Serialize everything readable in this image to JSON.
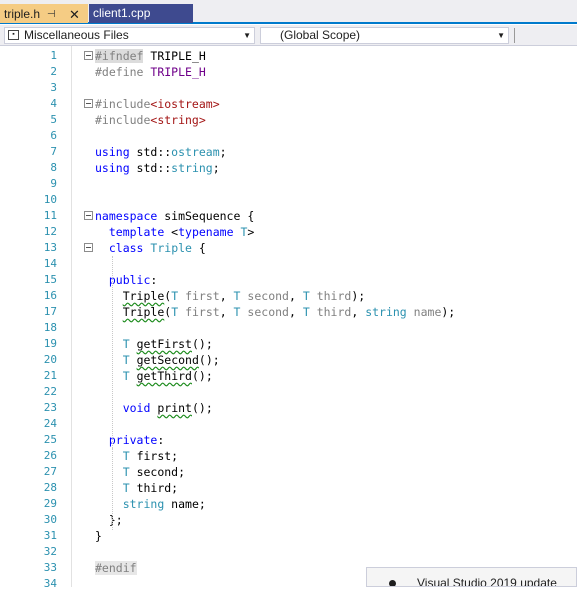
{
  "tabs": [
    {
      "label": "triple.h",
      "active": true
    },
    {
      "label": "client1.cpp",
      "active": false
    }
  ],
  "tab_icons": {
    "pin": "pin-icon",
    "close": "close-icon"
  },
  "navbar": {
    "files_dropdown": "Miscellaneous Files",
    "scope_dropdown": "(Global Scope)"
  },
  "colors": {
    "accent": "#007acc",
    "active_tab": "#f5cc84",
    "inactive_tab": "#3e4a8f",
    "line_numbers": "#2b91af",
    "keyword": "#0000ff",
    "string": "#a31515"
  },
  "editor": {
    "lines": [
      {
        "n": "1",
        "text": "#ifndef TRIPLE_H"
      },
      {
        "n": "2",
        "text": "#define TRIPLE_H"
      },
      {
        "n": "3",
        "text": ""
      },
      {
        "n": "4",
        "text": "#include<iostream>"
      },
      {
        "n": "5",
        "text": "#include<string>"
      },
      {
        "n": "6",
        "text": ""
      },
      {
        "n": "7",
        "text": "using std::ostream;"
      },
      {
        "n": "8",
        "text": "using std::string;"
      },
      {
        "n": "9",
        "text": ""
      },
      {
        "n": "10",
        "text": ""
      },
      {
        "n": "11",
        "text": "namespace simSequence {"
      },
      {
        "n": "12",
        "text": "  template <typename T>"
      },
      {
        "n": "13",
        "text": "  class Triple {"
      },
      {
        "n": "14",
        "text": ""
      },
      {
        "n": "15",
        "text": "  public:"
      },
      {
        "n": "16",
        "text": "    Triple(T first, T second, T third);"
      },
      {
        "n": "17",
        "text": "    Triple(T first, T second, T third, string name);"
      },
      {
        "n": "18",
        "text": ""
      },
      {
        "n": "19",
        "text": "    T getFirst();"
      },
      {
        "n": "20",
        "text": "    T getSecond();"
      },
      {
        "n": "21",
        "text": "    T getThird();"
      },
      {
        "n": "22",
        "text": ""
      },
      {
        "n": "23",
        "text": "    void print();"
      },
      {
        "n": "24",
        "text": ""
      },
      {
        "n": "25",
        "text": "  private:"
      },
      {
        "n": "26",
        "text": "    T first;"
      },
      {
        "n": "27",
        "text": "    T second;"
      },
      {
        "n": "28",
        "text": "    T third;"
      },
      {
        "n": "29",
        "text": "    string name;"
      },
      {
        "n": "30",
        "text": "  };"
      },
      {
        "n": "31",
        "text": "}"
      },
      {
        "n": "32",
        "text": ""
      },
      {
        "n": "33",
        "text": "#endif"
      },
      {
        "n": "34",
        "text": ""
      }
    ]
  },
  "notification": {
    "text": "Visual Studio 2019 update"
  }
}
